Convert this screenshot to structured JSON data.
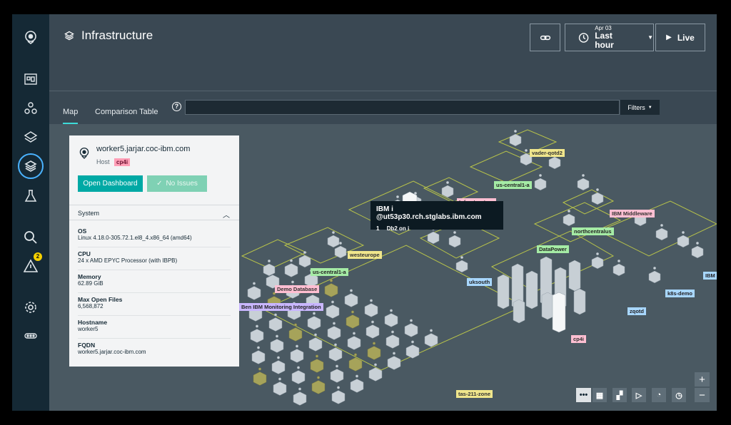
{
  "header": {
    "title": "Infrastructure",
    "date": "Apr 03",
    "range": "Last hour",
    "live": "Live"
  },
  "sidebar": {
    "items": [
      {
        "icon": "logo-icon"
      },
      {
        "icon": "applications-icon"
      },
      {
        "icon": "services-icon"
      },
      {
        "icon": "platforms-icon"
      },
      {
        "icon": "infrastructure-icon"
      },
      {
        "icon": "analytics-icon"
      },
      {
        "icon": "search-icon"
      },
      {
        "icon": "events-icon",
        "badge": "2"
      },
      {
        "icon": "settings-icon"
      },
      {
        "icon": "more-icon"
      }
    ]
  },
  "tabs": {
    "map": "Map",
    "comparison": "Comparison Table"
  },
  "search": {
    "value": ""
  },
  "filters": {
    "label": "Filters"
  },
  "panel": {
    "host_name": "worker5.jarjar.coc-ibm.com",
    "host_label": "Host",
    "host_tag": "cp4i",
    "open_dashboard": "Open Dashboard",
    "no_issues": "No Issues",
    "section": "System",
    "properties": [
      {
        "label": "OS",
        "value": "Linux 4.18.0-305.72.1.el8_4.x86_64 (amd64)"
      },
      {
        "label": "CPU",
        "value": "24 x AMD EPYC Processor (with IBPB)"
      },
      {
        "label": "Memory",
        "value": "62.89 GiB"
      },
      {
        "label": "Max Open Files",
        "value": "6,568,872"
      },
      {
        "label": "Hostname",
        "value": "worker5"
      },
      {
        "label": "FQDN",
        "value": "worker5.jarjar.coc-ibm.com"
      }
    ]
  },
  "tooltip": {
    "title": "IBM i @ut53p30.rch.stglabs.ibm.com",
    "count": "1",
    "name": "Db2 on i"
  },
  "map_labels": {
    "vader": "vader-qotd2",
    "uscentral_top": "us-central1-a",
    "infrastructure": "Infrastructure",
    "ibm_middleware": "IBM Middleware",
    "northcentralus": "northcentralus",
    "datapower": "DataPower",
    "westeurope": "westeurope",
    "uscentral_left": "us-central1-a",
    "uksouth": "uksouth",
    "demo_db": "Demo Database",
    "ben": "Ben IBM Monitoring Integration",
    "k8s": "k8s-demo",
    "zqotd": "zqotd",
    "ibm_edge": "IBM",
    "cp4i": "cp4i",
    "tas": "tas-211-zone"
  },
  "controls": {
    "zoom_in": "+",
    "zoom_out": "−"
  }
}
